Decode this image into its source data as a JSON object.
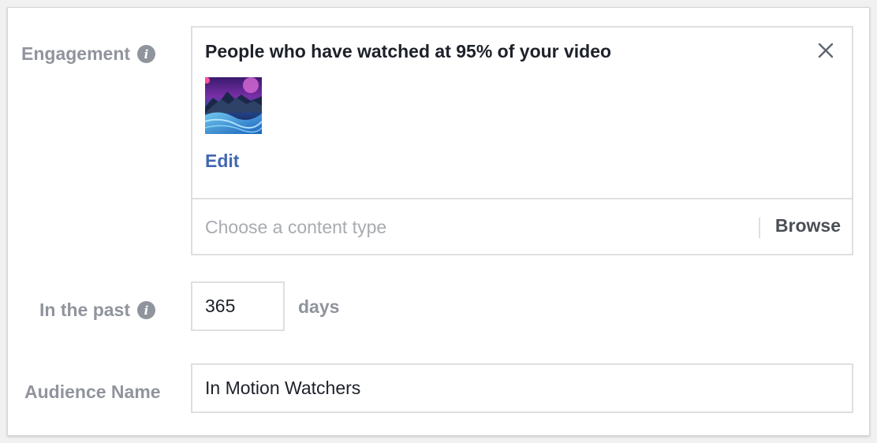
{
  "engagement": {
    "label": "Engagement",
    "info_icon": "i",
    "selected_title": "People who have watched at 95% of your video",
    "thumbnail_icon": "video-thumbnail-image",
    "edit_label": "Edit",
    "content_type_placeholder": "Choose a content type",
    "browse_label": "Browse"
  },
  "retention": {
    "label": "In the past",
    "info_icon": "i",
    "value": "365",
    "suffix": "days"
  },
  "audience_name": {
    "label": "Audience Name",
    "value": "In Motion Watchers"
  },
  "colors": {
    "label_gray": "#90949c",
    "link_blue": "#4267b2",
    "border": "#dddfe2",
    "text": "#1d2129"
  }
}
